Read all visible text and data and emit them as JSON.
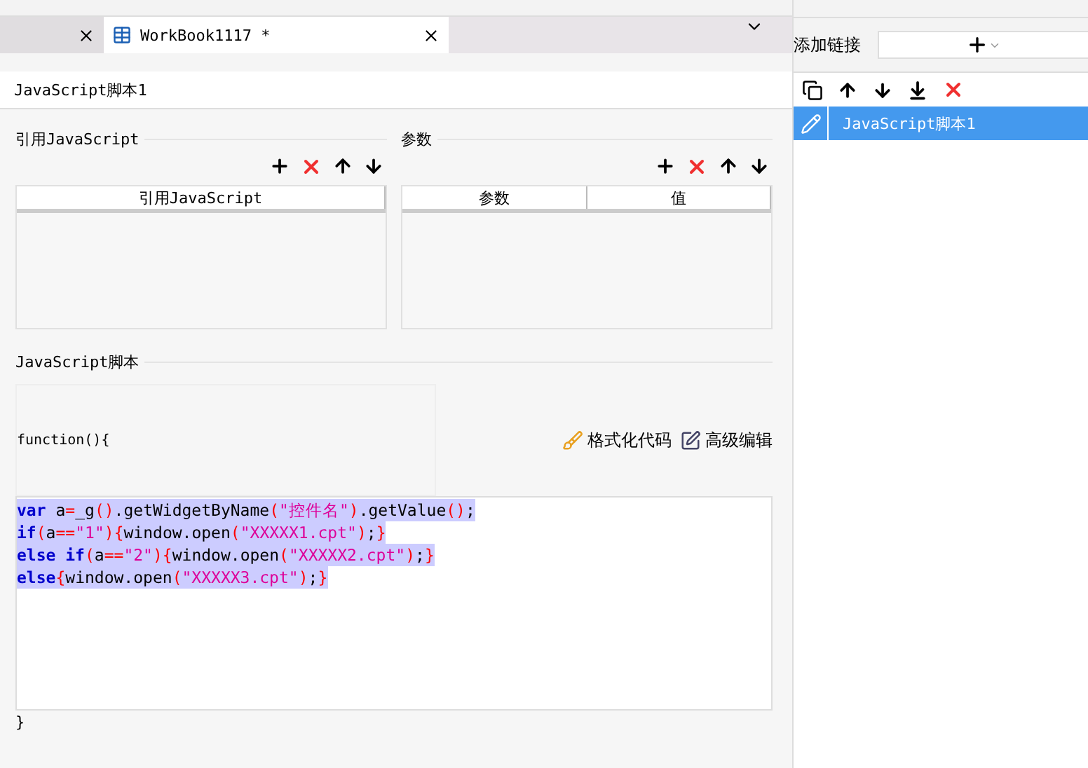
{
  "tabs": [
    {
      "selected": false
    },
    {
      "label": "WorkBook1117 *",
      "selected": true
    }
  ],
  "dialog": {
    "title": "JavaScript脚本1",
    "ref_section": {
      "title": "引用JavaScript",
      "columns": [
        "引用JavaScript"
      ]
    },
    "param_section": {
      "title": "参数",
      "columns": [
        "参数",
        "值"
      ]
    },
    "script_section": {
      "title": "JavaScript脚本",
      "header": "function(){",
      "footer": "}",
      "format_button": "格式化代码",
      "advanced_button": "高级编辑",
      "code": [
        [
          {
            "kind": "keyword",
            "text": "var"
          },
          {
            "kind": "plain",
            "text": " a"
          },
          {
            "kind": "operator",
            "text": "="
          },
          {
            "kind": "plain",
            "text": "_g"
          },
          {
            "kind": "operator",
            "text": "()"
          },
          {
            "kind": "plain",
            "text": ".getWidgetByName"
          },
          {
            "kind": "operator",
            "text": "("
          },
          {
            "kind": "string",
            "text": "\"控件名\""
          },
          {
            "kind": "operator",
            "text": ")"
          },
          {
            "kind": "plain",
            "text": ".getValue"
          },
          {
            "kind": "operator",
            "text": "()"
          },
          {
            "kind": "plain",
            "text": ";"
          }
        ],
        [
          {
            "kind": "keyword",
            "text": "if"
          },
          {
            "kind": "operator",
            "text": "("
          },
          {
            "kind": "plain",
            "text": "a"
          },
          {
            "kind": "operator",
            "text": "=="
          },
          {
            "kind": "string",
            "text": "\"1\""
          },
          {
            "kind": "operator",
            "text": ")"
          },
          {
            "kind": "operator",
            "text": "{"
          },
          {
            "kind": "plain",
            "text": "window.open"
          },
          {
            "kind": "operator",
            "text": "("
          },
          {
            "kind": "string",
            "text": "\"XXXXX1.cpt\""
          },
          {
            "kind": "operator",
            "text": ")"
          },
          {
            "kind": "plain",
            "text": ";"
          },
          {
            "kind": "operator",
            "text": "}"
          }
        ],
        [
          {
            "kind": "keyword",
            "text": "else if"
          },
          {
            "kind": "operator",
            "text": "("
          },
          {
            "kind": "plain",
            "text": "a"
          },
          {
            "kind": "operator",
            "text": "=="
          },
          {
            "kind": "string",
            "text": "\"2\""
          },
          {
            "kind": "operator",
            "text": ")"
          },
          {
            "kind": "operator",
            "text": "{"
          },
          {
            "kind": "plain",
            "text": "window.open"
          },
          {
            "kind": "operator",
            "text": "("
          },
          {
            "kind": "string",
            "text": "\"XXXXX2.cpt\""
          },
          {
            "kind": "operator",
            "text": ")"
          },
          {
            "kind": "plain",
            "text": ";"
          },
          {
            "kind": "operator",
            "text": "}"
          }
        ],
        [
          {
            "kind": "keyword",
            "text": "else"
          },
          {
            "kind": "operator",
            "text": "{"
          },
          {
            "kind": "plain",
            "text": "window.open"
          },
          {
            "kind": "operator",
            "text": "("
          },
          {
            "kind": "string",
            "text": "\"XXXXX3.cpt\""
          },
          {
            "kind": "operator",
            "text": ")"
          },
          {
            "kind": "plain",
            "text": ";"
          },
          {
            "kind": "operator",
            "text": "}"
          }
        ]
      ]
    }
  },
  "link_panel": {
    "add_label": "添加链接",
    "items": [
      {
        "label": "JavaScript脚本1",
        "selected": true
      }
    ]
  }
}
